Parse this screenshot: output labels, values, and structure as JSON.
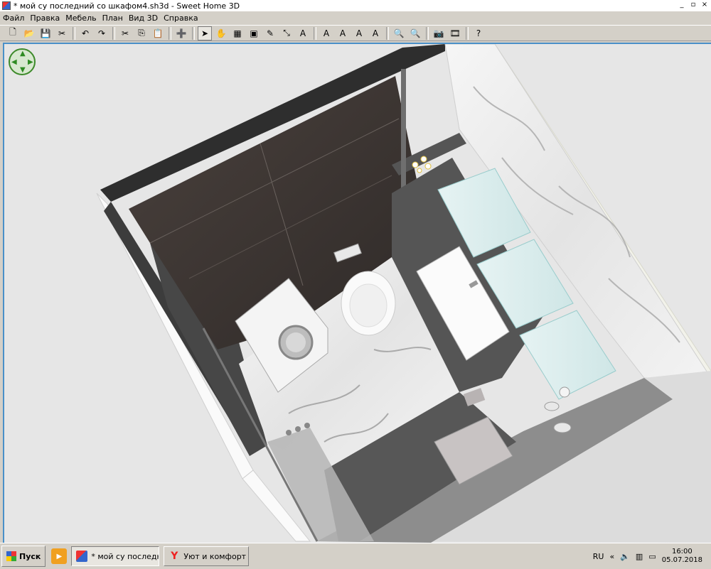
{
  "window": {
    "title": "* мой су последний со шкафом4.sh3d - Sweet Home 3D",
    "buttons": [
      "_",
      "▫",
      "×"
    ]
  },
  "menu": [
    "Файл",
    "Правка",
    "Мебель",
    "План",
    "Вид 3D",
    "Справка"
  ],
  "toolbar": [
    {
      "name": "new-icon",
      "glyph": "🗋"
    },
    {
      "name": "open-icon",
      "glyph": "📂"
    },
    {
      "name": "save-icon",
      "glyph": "💾"
    },
    {
      "name": "preferences-icon",
      "glyph": "✂"
    },
    {
      "sep": true
    },
    {
      "name": "undo-icon",
      "glyph": "↶"
    },
    {
      "name": "redo-icon",
      "glyph": "↷"
    },
    {
      "sep": true
    },
    {
      "name": "cut-icon",
      "glyph": "✂"
    },
    {
      "name": "copy-icon",
      "glyph": "⎘"
    },
    {
      "name": "paste-icon",
      "glyph": "📋"
    },
    {
      "sep": true
    },
    {
      "name": "add-furniture-icon",
      "glyph": "➕"
    },
    {
      "sep": true
    },
    {
      "name": "select-icon",
      "glyph": "➤",
      "active": true
    },
    {
      "name": "pan-icon",
      "glyph": "✋"
    },
    {
      "name": "create-walls-icon",
      "glyph": "▦"
    },
    {
      "name": "create-rooms-icon",
      "glyph": "▣"
    },
    {
      "name": "create-polylines-icon",
      "glyph": "✎"
    },
    {
      "name": "create-dimensions-icon",
      "glyph": "⤡"
    },
    {
      "name": "create-labels-icon",
      "glyph": "A"
    },
    {
      "sep": true
    },
    {
      "name": "increase-text-icon",
      "glyph": "A"
    },
    {
      "name": "decrease-text-icon",
      "glyph": "A"
    },
    {
      "name": "bold-text-icon",
      "glyph": "A"
    },
    {
      "name": "italic-text-icon",
      "glyph": "A"
    },
    {
      "sep": true
    },
    {
      "name": "zoom-in-icon",
      "glyph": "🔍"
    },
    {
      "name": "zoom-out-icon",
      "glyph": "🔍"
    },
    {
      "sep": true
    },
    {
      "name": "create-photo-icon",
      "glyph": "📷"
    },
    {
      "name": "create-video-icon",
      "glyph": "🎞"
    },
    {
      "sep": true
    },
    {
      "name": "help-icon",
      "glyph": "?"
    }
  ],
  "taskbar": {
    "start_label": "Пуск",
    "tasks": [
      {
        "label": "* мой су последни...",
        "active": true
      },
      {
        "label": "Уют и комфорт в с...",
        "active": false
      }
    ],
    "language": "RU",
    "time": "16:00",
    "date": "05.07.2018"
  },
  "colors": {
    "viewport_border": "#4a90c8",
    "dark_wood": "#3f3835",
    "marble": "#eeeeee",
    "floor_dark": "#555555",
    "nav_green": "#3d8a2a"
  }
}
